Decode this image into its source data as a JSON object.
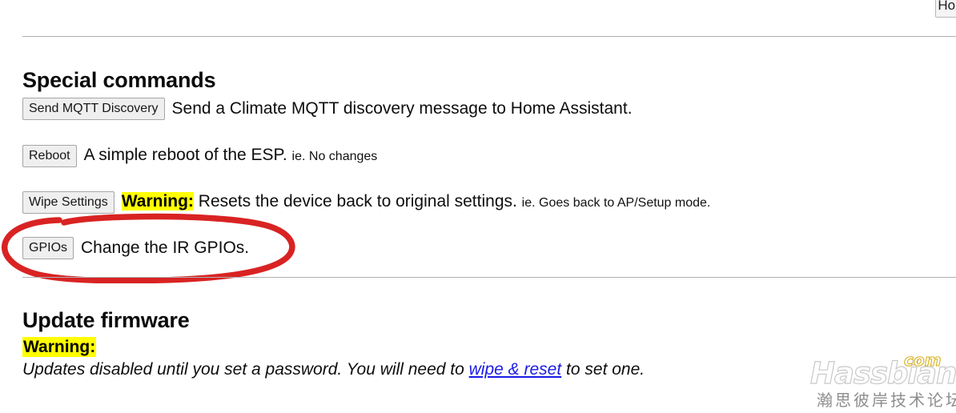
{
  "topbar": {
    "home_button_label": "Home"
  },
  "special_commands": {
    "heading": "Special commands",
    "rows": [
      {
        "button_label": "Send MQTT Discovery",
        "description": "Send a Climate MQTT discovery message to Home Assistant.",
        "warning_label": "",
        "note": ""
      },
      {
        "button_label": "Reboot",
        "description": "A simple reboot of the ESP.",
        "warning_label": "",
        "note": "ie. No changes"
      },
      {
        "button_label": "Wipe Settings",
        "description": "Resets the device back to original settings.",
        "warning_label": "Warning:",
        "note": "ie. Goes back to AP/Setup mode."
      },
      {
        "button_label": "GPIOs",
        "description": "Change the IR GPIOs.",
        "warning_label": "",
        "note": ""
      }
    ]
  },
  "update_firmware": {
    "heading": "Update firmware",
    "warning_label": "Warning:",
    "message_before_link": "Updates disabled until you set a password. You will need to ",
    "link_text": "wipe & reset",
    "message_after_link": " to set one."
  },
  "annotation": {
    "shape": "red-ellipse-highlight",
    "color": "#d92323",
    "targets": "gpios-row"
  },
  "watermark": {
    "brand": "Hassbian",
    "tld": "com",
    "subtitle": "瀚思彼岸技术论坛",
    "brand_color": "#c9c9c9",
    "tld_color": "#d6b21e",
    "subtitle_color": "#8e8e8e"
  }
}
